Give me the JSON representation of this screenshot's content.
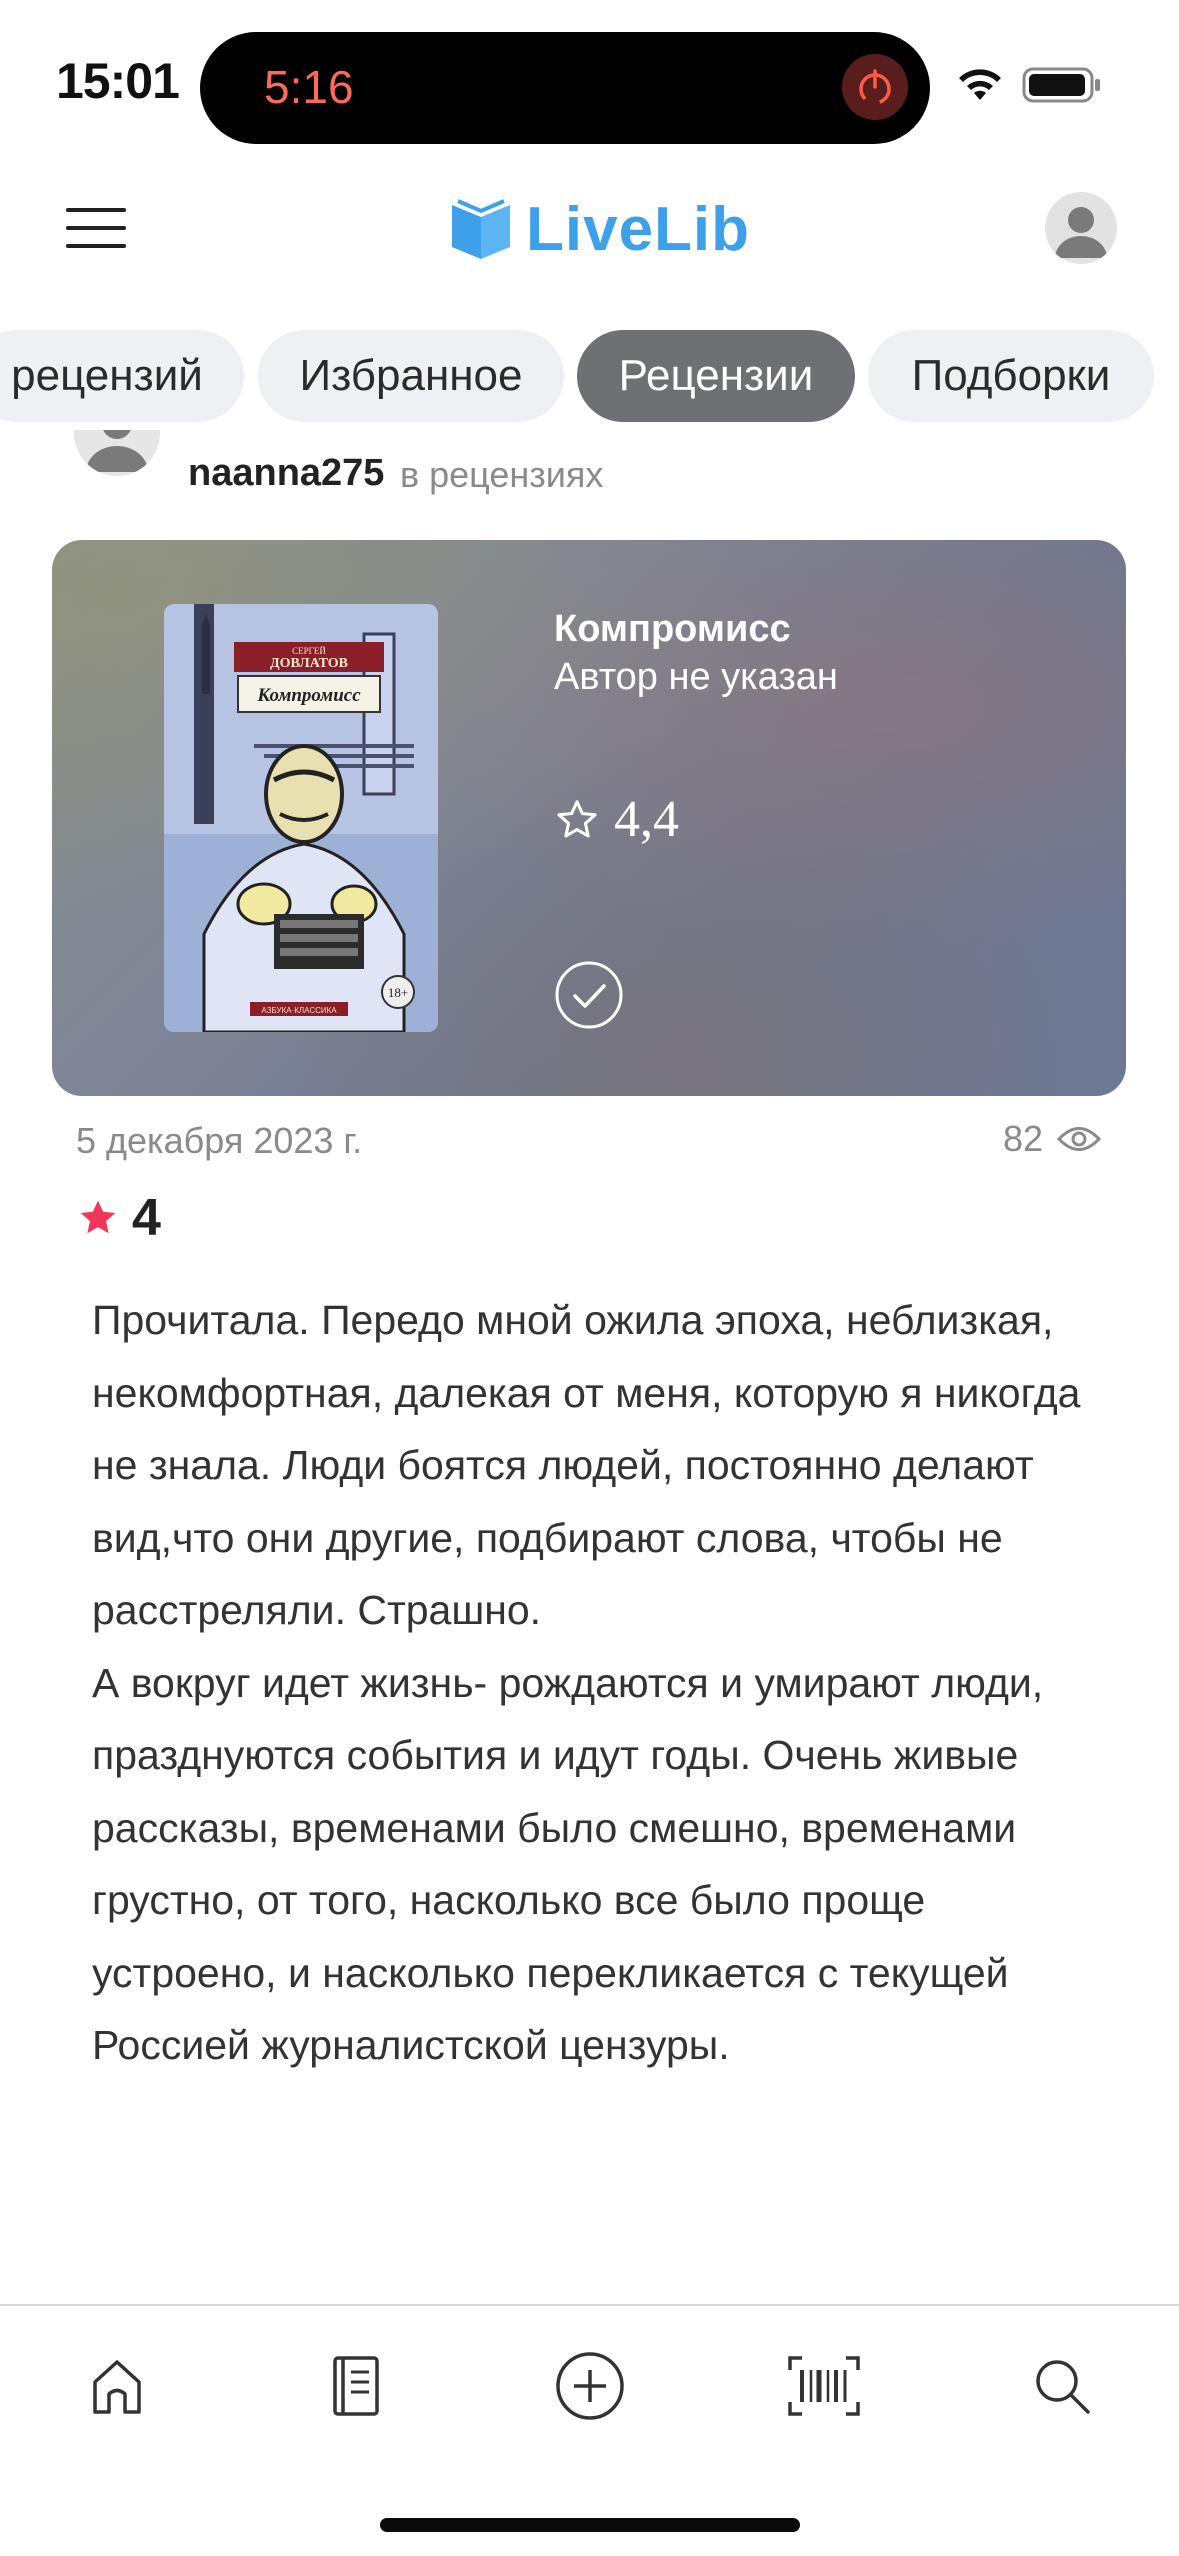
{
  "status_bar": {
    "time": "15:01",
    "timer": "5:16"
  },
  "header": {
    "logo_text": "LiveLib",
    "brand_color": "#3fa0ea"
  },
  "tabs": [
    {
      "label": "рецензий",
      "active": false
    },
    {
      "label": "Избранное",
      "active": false
    },
    {
      "label": "Рецензии",
      "active": true
    },
    {
      "label": "Подборки",
      "active": false
    }
  ],
  "review": {
    "author_name": "naanna275",
    "author_context": "в рецензиях",
    "book": {
      "title": "Компромисс",
      "author": "Автор не указан",
      "rating": "4,4",
      "cover": {
        "author_line1": "СЕРГЕЙ",
        "author_line2": "ДОВЛАТОВ",
        "title": "Компромисс",
        "age": "18+",
        "series": "АЗБУКА·КЛАССИКА"
      }
    },
    "date": "5 декабря 2023 г.",
    "views": "82",
    "user_rating": "4",
    "rating_color": "#f0365a",
    "text": [
      "Прочитала. Передо мной ожила эпоха, неблизкая, некомфортная, далекая от меня, которую я никогда не знала. Люди боятся людей, постоянно делают вид,что они другие, подбирают слова, чтобы не расстреляли. Страшно.",
      "А вокруг идет жизнь- рождаются и умирают люди, празднуются события и идут годы. Очень живые рассказы, временами было смешно, временами грустно, от того, насколько все было проще устроено, и насколько перекликается с текущей Россией журналистской цензуры."
    ]
  },
  "bottom_nav": [
    {
      "icon": "home-icon"
    },
    {
      "icon": "book-list-icon"
    },
    {
      "icon": "add-circle-icon"
    },
    {
      "icon": "barcode-scan-icon"
    },
    {
      "icon": "search-icon"
    }
  ]
}
